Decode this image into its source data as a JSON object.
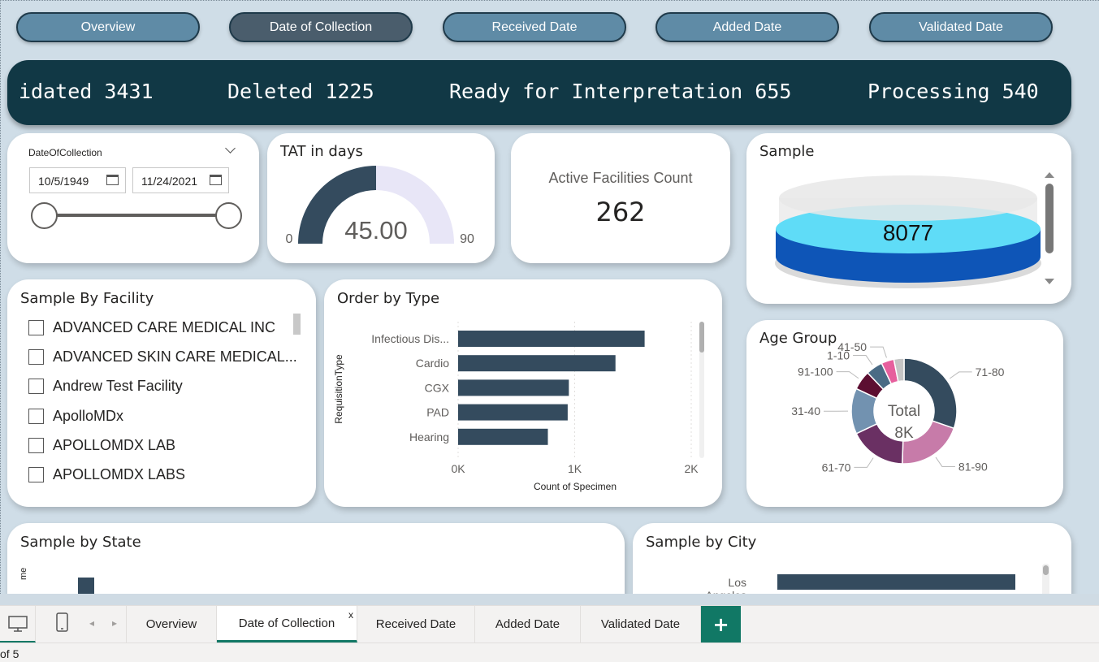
{
  "nav": {
    "buttons": [
      "Overview",
      "Date of Collection",
      "Received Date",
      "Added Date",
      "Validated Date"
    ],
    "active_index": 1
  },
  "ticker": {
    "items": [
      "idated 3431",
      "Deleted 1225",
      "Ready for Interpretation 655",
      "Processing 540"
    ]
  },
  "date_slicer": {
    "label": "DateOfCollection",
    "start": "10/5/1949",
    "end": "11/24/2021"
  },
  "tat": {
    "title": "TAT in days",
    "value": 45.0,
    "value_label": "45.00",
    "min": "0",
    "max": "90",
    "fill_color": "#344b5e",
    "rest_color": "#e8e6f7"
  },
  "facilities": {
    "label": "Active Facilities Count",
    "value": "262"
  },
  "sample": {
    "title": "Sample",
    "value": "8077"
  },
  "sample_by_facility": {
    "title": "Sample By Facility",
    "items": [
      "ADVANCED CARE MEDICAL INC",
      "ADVANCED SKIN CARE MEDICAL...",
      "Andrew Test Facility",
      "ApolloMDx",
      "APOLLOMDX LAB",
      "APOLLOMDX LABS"
    ]
  },
  "order_by_type": {
    "title": "Order by Type",
    "y_axis_label": "RequisitionType",
    "x_axis_label": "Count of Specimen",
    "x_ticks": [
      "0K",
      "1K",
      "2K"
    ]
  },
  "age_group": {
    "title": "Age Group",
    "center_label": "Total",
    "center_value": "8K"
  },
  "sample_by_state": {
    "title": "Sample by State",
    "axis_label_fragment": "me"
  },
  "sample_by_city": {
    "title": "Sample by City",
    "first_label": "Los Angeles"
  },
  "chart_data": [
    {
      "type": "bar",
      "orientation": "horizontal",
      "title": "Order by Type",
      "categories": [
        "Infectious Dis...",
        "Cardio",
        "CGX",
        "PAD",
        "Hearing"
      ],
      "values": [
        1600,
        1350,
        950,
        940,
        770
      ],
      "xlabel": "Count of Specimen",
      "ylabel": "RequisitionType",
      "xlim": [
        0,
        2000
      ],
      "grid": true,
      "color": "#344b5e"
    },
    {
      "type": "pie",
      "title": "Age Group",
      "donut": true,
      "labels": [
        "71-80",
        "81-90",
        "61-70",
        "31-40",
        "91-100",
        "1-10",
        "41-50",
        "other"
      ],
      "values": [
        1950,
        1300,
        1120,
        900,
        380,
        330,
        250,
        200
      ],
      "labeled": [
        true,
        true,
        true,
        true,
        true,
        true,
        true,
        false
      ],
      "colors": [
        "#344b5e",
        "#c77ba9",
        "#6a3063",
        "#7292b0",
        "#5c0e31",
        "#4a6b85",
        "#e65f9d",
        "#c5c5c5"
      ]
    },
    {
      "type": "bar",
      "orientation": "horizontal",
      "title": "Sample by City",
      "categories": [
        "Los Angeles"
      ],
      "values": [
        1
      ],
      "color": "#344b5e"
    }
  ],
  "tabs": {
    "items": [
      "Overview",
      "Date of Collection",
      "Received Date",
      "Added Date",
      "Validated Date"
    ],
    "active_index": 1,
    "close_glyph": "x",
    "add_glyph": "+"
  },
  "status": {
    "page_text": "of 5"
  }
}
